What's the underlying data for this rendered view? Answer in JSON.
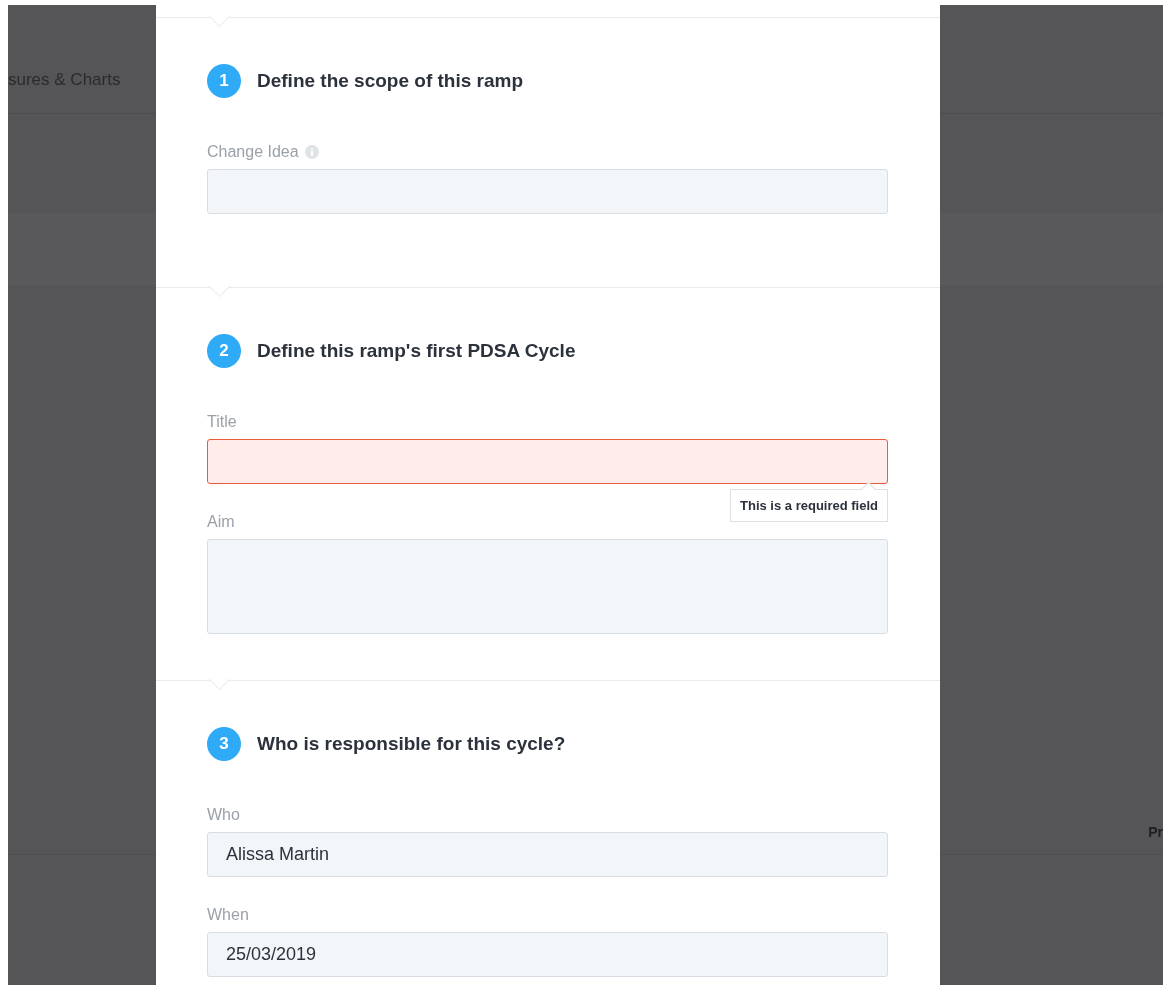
{
  "background": {
    "tab_label": "sures & Charts",
    "corner_text": "Pr"
  },
  "sections": [
    {
      "number": "1",
      "title": "Define the scope of this ramp",
      "fields": [
        {
          "kind": "input",
          "label": "Change Idea",
          "info": true,
          "invalid": false
        }
      ]
    },
    {
      "number": "2",
      "title": "Define this ramp's first PDSA Cycle",
      "fields": [
        {
          "kind": "input",
          "label": "Title",
          "invalid": true,
          "error": "This is a required field"
        },
        {
          "kind": "textarea",
          "label": "Aim",
          "invalid": false
        }
      ]
    },
    {
      "number": "3",
      "title": "Who is responsible for this cycle?",
      "fields": [
        {
          "kind": "input",
          "label": "Who",
          "invalid": false,
          "value": "Alissa Martin"
        },
        {
          "kind": "input",
          "label": "When",
          "invalid": false,
          "value": "25/03/2019"
        }
      ]
    }
  ]
}
